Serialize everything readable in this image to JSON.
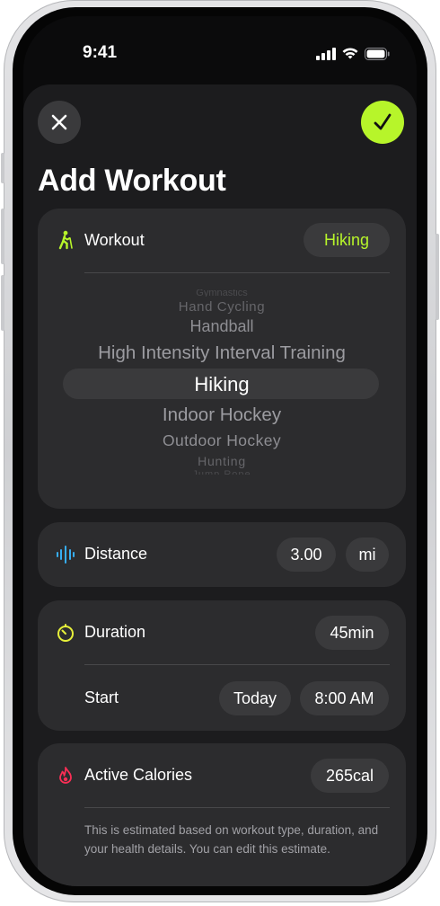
{
  "status_bar": {
    "time": "9:41"
  },
  "header": {
    "title": "Add Workout"
  },
  "workout": {
    "label": "Workout",
    "selected": "Hiking",
    "picker_items": [
      "Gymnastics",
      "Hand Cycling",
      "Handball",
      "High Intensity Interval Training",
      "Hiking",
      "Indoor Hockey",
      "Outdoor Hockey",
      "Hunting",
      "Jump Rope"
    ]
  },
  "distance": {
    "label": "Distance",
    "value": "3.00",
    "unit": "mi"
  },
  "duration": {
    "label": "Duration",
    "value": "45min",
    "start_label": "Start",
    "start_day": "Today",
    "start_time": "8:00 AM"
  },
  "calories": {
    "label": "Active Calories",
    "value": "265cal",
    "note": "This is estimated based on workout type, duration, and your health details. You can edit this estimate."
  },
  "colors": {
    "accent_green": "#b7f52a",
    "distance_blue": "#37aef3",
    "duration_yellow": "#e7f03a",
    "calories_red": "#fa2e55"
  }
}
